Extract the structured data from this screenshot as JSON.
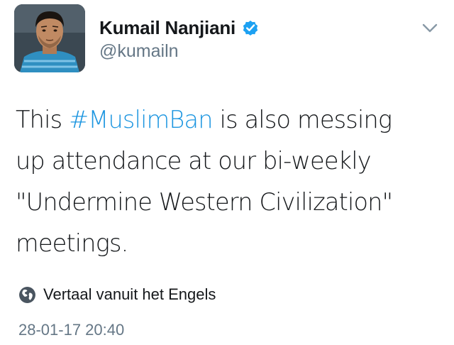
{
  "author": {
    "display_name": "Kumail Nanjiani",
    "handle": "@kumailn",
    "verified": true
  },
  "tweet": {
    "lines": [
      {
        "prefix": "This ",
        "hashtag": "#MuslimBan",
        "suffix": " is also messing"
      },
      {
        "text": "up attendance at our bi-weekly"
      },
      {
        "text": "\"Undermine Western Civilization\""
      },
      {
        "text": "meetings."
      }
    ]
  },
  "translate": {
    "label": "Vertaal vanuit het Engels",
    "icon": "globe-icon"
  },
  "timestamp": "28-01-17 20:40",
  "colors": {
    "hashtag": "#1b95e0",
    "verified": "#1da1f2",
    "secondary_text": "#657786",
    "primary_text": "#14171a"
  }
}
